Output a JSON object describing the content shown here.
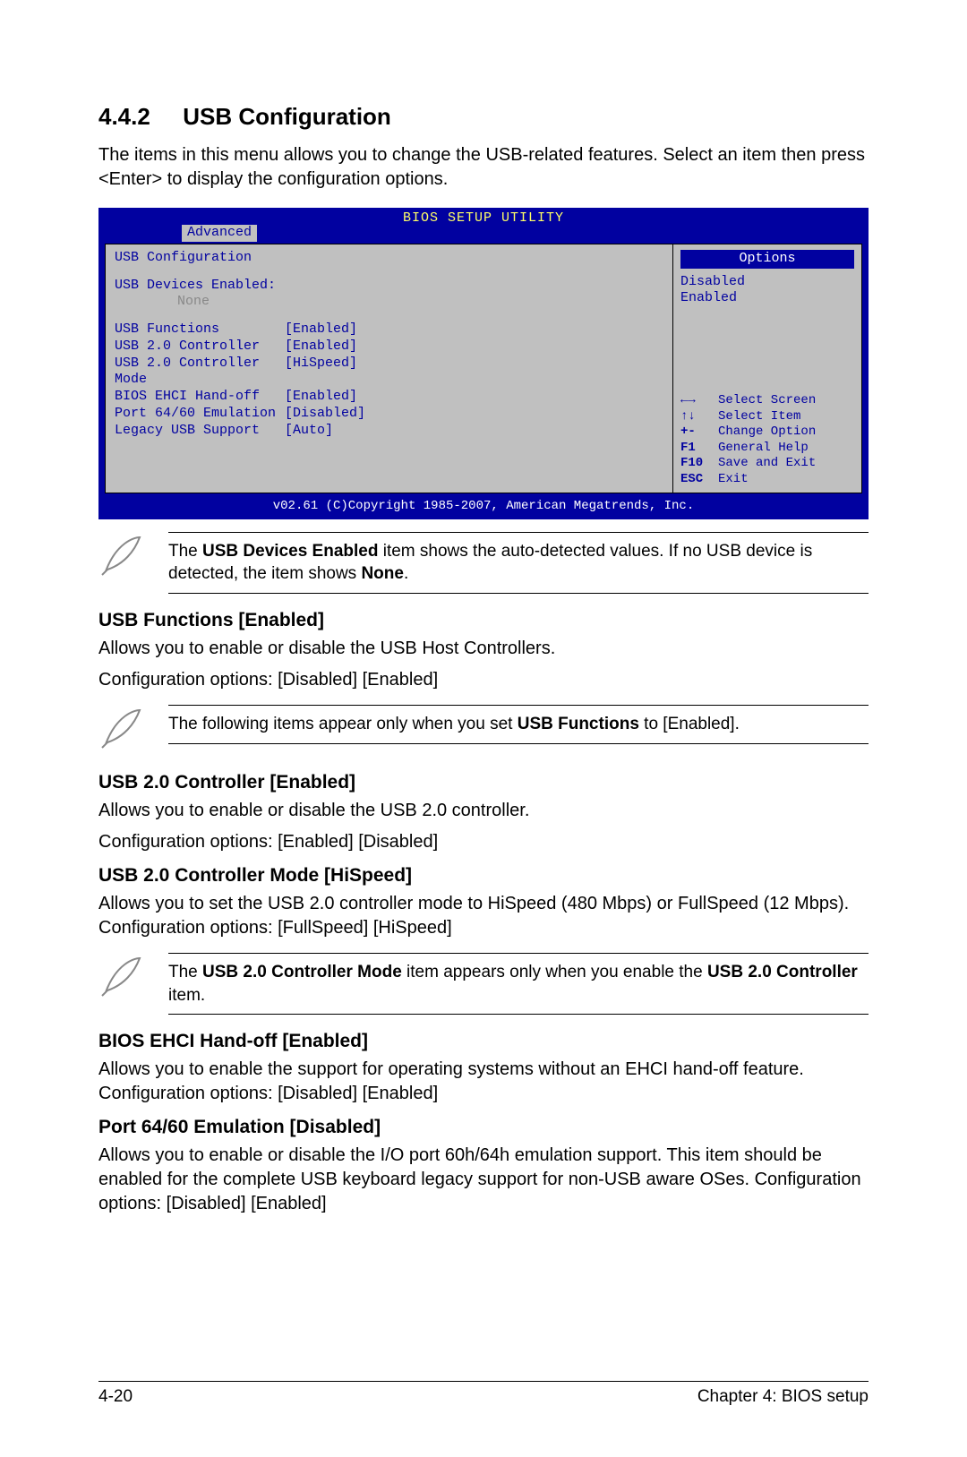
{
  "section": {
    "num": "4.4.2",
    "title": "USB Configuration"
  },
  "intro": "The items in this menu allows you to change the USB-related features. Select an item then press <Enter> to display the configuration options.",
  "bios": {
    "title": "BIOS SETUP UTILITY",
    "tab": "Advanced",
    "heading": "USB Configuration",
    "devices_label": "USB Devices Enabled:",
    "devices_none": "None",
    "rows": [
      {
        "lbl": "USB Functions",
        "val": "[Enabled]"
      },
      {
        "lbl": "USB 2.0 Controller",
        "val": "[Enabled]"
      },
      {
        "lbl": "USB 2.0 Controller Mode",
        "val": "[HiSpeed]"
      },
      {
        "lbl": "BIOS EHCI Hand-off",
        "val": "[Enabled]"
      },
      {
        "lbl": "Port 64/60 Emulation",
        "val": "[Disabled]"
      },
      {
        "lbl": "Legacy USB Support",
        "val": "[Auto]"
      }
    ],
    "options_header": "Options",
    "options": [
      "Disabled",
      "Enabled"
    ],
    "nav": [
      {
        "k": "←→",
        "t": "Select Screen"
      },
      {
        "k": "↑↓",
        "t": "Select Item"
      },
      {
        "k": "+-",
        "t": "Change Option"
      },
      {
        "k": "F1",
        "t": "General Help"
      },
      {
        "k": "F10",
        "t": "Save and Exit"
      },
      {
        "k": "ESC",
        "t": "Exit"
      }
    ],
    "footer": "v02.61 (C)Copyright 1985-2007, American Megatrends, Inc."
  },
  "note1": {
    "pre": "The ",
    "b1": "USB Devices Enabled",
    "mid": " item shows the auto-detected values. If no USB device is detected, the item shows ",
    "b2": "None",
    "post": "."
  },
  "s1": {
    "h": "USB Functions [Enabled]",
    "p1": "Allows you to enable or disable the USB Host Controllers.",
    "p2": "Configuration options: [Disabled] [Enabled]"
  },
  "note2": {
    "pre": "The following items appear only when you set ",
    "b1": "USB Functions",
    "post": " to [Enabled]."
  },
  "s2": {
    "h": "USB 2.0 Controller [Enabled]",
    "p1": "Allows you to enable or disable the USB 2.0 controller.",
    "p2": "Configuration options: [Enabled] [Disabled]"
  },
  "s3": {
    "h": "USB 2.0 Controller Mode [HiSpeed]",
    "p": "Allows you to set the USB 2.0 controller mode to HiSpeed (480 Mbps) or FullSpeed (12 Mbps). Configuration options: [FullSpeed] [HiSpeed]"
  },
  "note3": {
    "pre": "The ",
    "b1": "USB 2.0 Controller Mode",
    "mid": " item appears only when you enable the ",
    "b2": "USB 2.0 Controller",
    "post": " item."
  },
  "s4": {
    "h": "BIOS EHCI Hand-off [Enabled]",
    "p": "Allows you to enable the support for operating systems without an EHCI hand-off feature. Configuration options: [Disabled] [Enabled]"
  },
  "s5": {
    "h": "Port 64/60 Emulation [Disabled]",
    "p": "Allows you to enable or disable the I/O port 60h/64h emulation support. This item should be enabled for the complete USB keyboard legacy support for non-USB aware OSes. Configuration options: [Disabled] [Enabled]"
  },
  "footer": {
    "left": "4-20",
    "right": "Chapter 4: BIOS setup"
  }
}
